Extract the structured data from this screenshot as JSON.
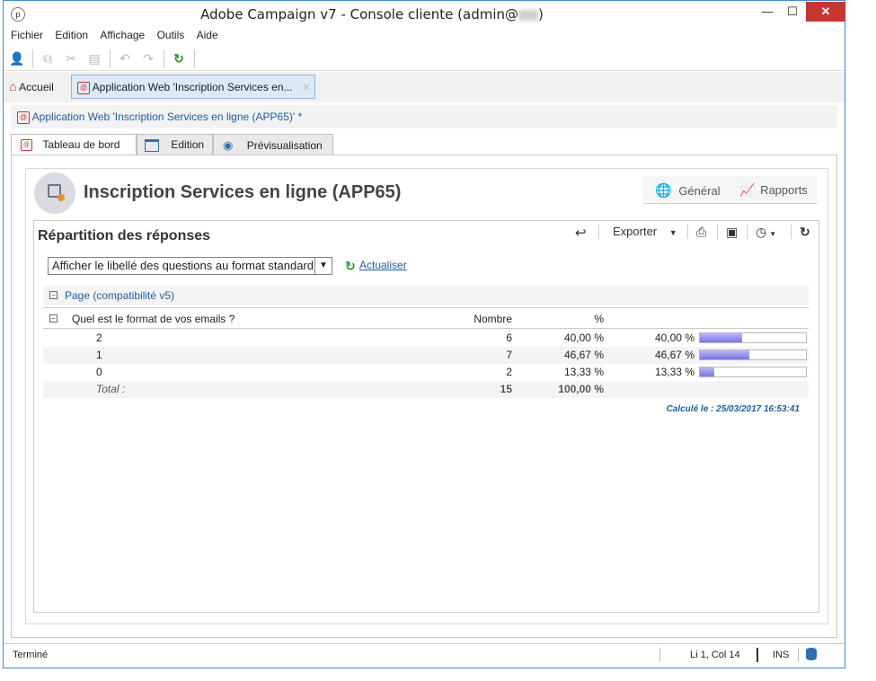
{
  "window": {
    "title": "Adobe Campaign v7 - Console cliente (admin@",
    "title_suffix": ")",
    "minimize": "—",
    "maximize": "☐",
    "close": "✕"
  },
  "menu": [
    "Fichier",
    "Edition",
    "Affichage",
    "Outils",
    "Aide"
  ],
  "doc_tabs": {
    "home": "Accueil",
    "active": "Application Web 'Inscription Services en..."
  },
  "breadcrumb": "Application Web 'Inscription Services en ligne (APP65)' *",
  "sub_tabs": [
    "Tableau de bord",
    "Edition",
    "Prévisualisation"
  ],
  "header": {
    "title": "Inscription Services en ligne (APP65)",
    "general": "Général",
    "reports": "Rapports"
  },
  "report": {
    "title": "Répartition des réponses",
    "export": "Exporter",
    "select_value": "Afficher le libellé des questions au format standard",
    "refresh": "Actualiser",
    "group": "Page (compatibilité v5)",
    "question": "Quel est le format de vos emails ?",
    "col_count": "Nombre",
    "col_pct": "%",
    "rows": [
      {
        "label": "2",
        "count": "6",
        "pct": "40,00 %",
        "pct2": "40,00 %",
        "fraction": 0.4
      },
      {
        "label": "1",
        "count": "7",
        "pct": "46,67 %",
        "pct2": "46,67 %",
        "fraction": 0.4667
      },
      {
        "label": "0",
        "count": "2",
        "pct": "13,33 %",
        "pct2": "13,33 %",
        "fraction": 0.1333
      }
    ],
    "total_label": "Total :",
    "total_count": "15",
    "total_pct": "100,00 %",
    "computed": "Calculé le : 25/03/2017 16:53:41"
  },
  "status": {
    "left": "Terminé",
    "position": "Li 1, Col 14",
    "mode": "INS"
  },
  "colors": {
    "accent": "#1d5fa7",
    "close_button": "#c7362f",
    "bar_fill": "#7b74e8"
  }
}
